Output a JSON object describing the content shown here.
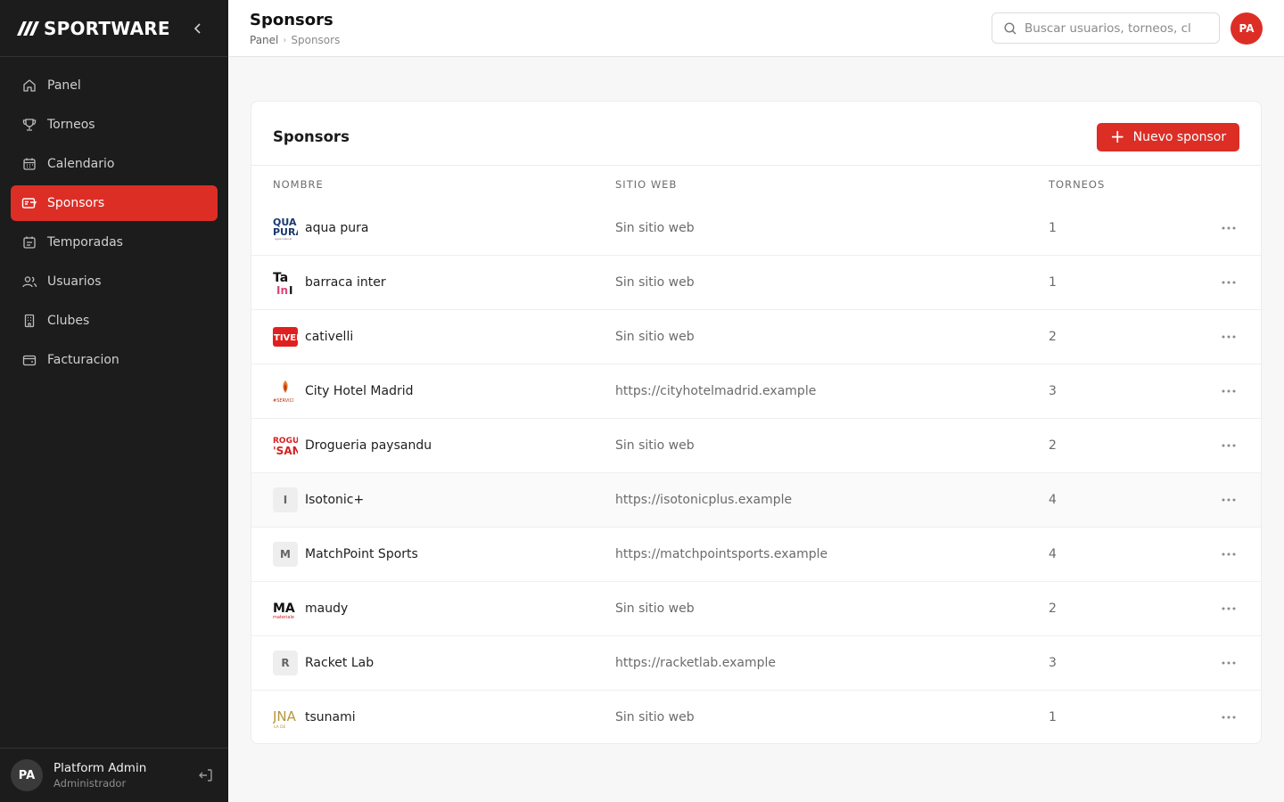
{
  "brand": {
    "name": "SPORTWARE"
  },
  "colors": {
    "accent": "#dd2e26",
    "sidebar_bg": "#1c1c1c"
  },
  "sidebar": {
    "items": [
      {
        "label": "Panel",
        "icon": "home-icon",
        "active": false
      },
      {
        "label": "Torneos",
        "icon": "trophy-icon",
        "active": false
      },
      {
        "label": "Calendario",
        "icon": "calendar-icon",
        "active": false
      },
      {
        "label": "Sponsors",
        "icon": "ticket-icon",
        "active": true
      },
      {
        "label": "Temporadas",
        "icon": "calendar-list-icon",
        "active": false
      },
      {
        "label": "Usuarios",
        "icon": "users-icon",
        "active": false
      },
      {
        "label": "Clubes",
        "icon": "building-icon",
        "active": false
      },
      {
        "label": "Facturacion",
        "icon": "wallet-icon",
        "active": false
      }
    ],
    "user": {
      "initials": "PA",
      "name": "Platform Admin",
      "role": "Administrador"
    }
  },
  "header": {
    "title": "Sponsors",
    "breadcrumb": [
      "Panel",
      "Sponsors"
    ],
    "search_placeholder": "Buscar usuarios, torneos, cl",
    "avatar_initials": "PA"
  },
  "card": {
    "title": "Sponsors",
    "new_button": "Nuevo sponsor",
    "columns": [
      "NOMBRE",
      "SITIO WEB",
      "TORNEOS"
    ],
    "rows": [
      {
        "name": "aqua pura",
        "site": "Sin sitio web",
        "count": "1",
        "logo": "aqua-pura-logo"
      },
      {
        "name": "barraca inter",
        "site": "Sin sitio web",
        "count": "1",
        "logo": "barraca-inter-logo"
      },
      {
        "name": "cativelli",
        "site": "Sin sitio web",
        "count": "2",
        "logo": "cativelli-logo"
      },
      {
        "name": "City Hotel Madrid",
        "site": "https://cityhotelmadrid.example",
        "count": "3",
        "logo": "city-hotel-logo"
      },
      {
        "name": "Drogueria paysandu",
        "site": "Sin sitio web",
        "count": "2",
        "logo": "drogueria-logo"
      },
      {
        "name": "Isotonic+",
        "site": "https://isotonicplus.example",
        "count": "4",
        "logo_letter": "I"
      },
      {
        "name": "MatchPoint Sports",
        "site": "https://matchpointsports.example",
        "count": "4",
        "logo_letter": "M"
      },
      {
        "name": "maudy",
        "site": "Sin sitio web",
        "count": "2",
        "logo": "maudy-logo"
      },
      {
        "name": "Racket Lab",
        "site": "https://racketlab.example",
        "count": "3",
        "logo_letter": "R"
      },
      {
        "name": "tsunami",
        "site": "Sin sitio web",
        "count": "1",
        "logo": "tsunami-logo"
      }
    ]
  }
}
